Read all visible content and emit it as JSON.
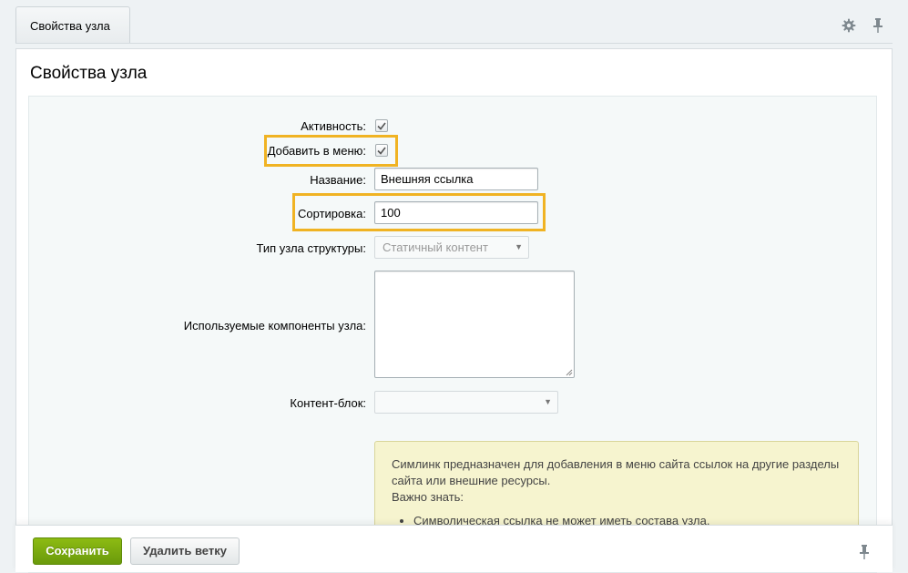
{
  "tab": {
    "label": "Свойства узла"
  },
  "title": "Свойства узла",
  "form": {
    "active_label": "Активность:",
    "add_menu_label": "Добавить в меню:",
    "name_label": "Название:",
    "name_value": "Внешняя ссылка",
    "sort_label": "Сортировка:",
    "sort_value": "100",
    "node_type_label": "Тип узла структуры:",
    "node_type_value": "Статичный контент",
    "components_label": "Используемые компоненты узла:",
    "content_block_label": "Контент-блок:",
    "content_block_value": ""
  },
  "hint": {
    "text": "Симлинк предназначен для добавления в меню сайта ссылок на другие разделы сайта или внешние ресурсы.",
    "important": "Важно знать:",
    "item1": "Символическая ссылка не может иметь состава узла."
  },
  "footer": {
    "save": "Сохранить",
    "delete": "Удалить ветку"
  },
  "colors": {
    "highlight": "#f0b323",
    "save_button": "#7aab10"
  },
  "icons": [
    "gear-icon",
    "pin-icon"
  ]
}
